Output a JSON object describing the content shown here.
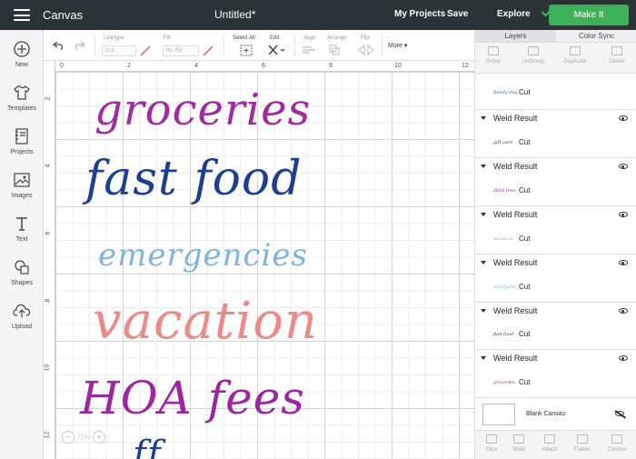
{
  "topbar": {
    "app_name": "Canvas",
    "doc_title": "Untitled*",
    "my_projects": "My Projects",
    "save": "Save",
    "explore": "Explore",
    "make_it": "Make It"
  },
  "sidebar": {
    "items": [
      {
        "label": "New",
        "icon": "plus-circle-icon"
      },
      {
        "label": "Templates",
        "icon": "shirt-icon"
      },
      {
        "label": "Projects",
        "icon": "notebook-icon"
      },
      {
        "label": "Images",
        "icon": "image-icon"
      },
      {
        "label": "Text",
        "icon": "text-icon"
      },
      {
        "label": "Shapes",
        "icon": "shapes-icon"
      },
      {
        "label": "Upload",
        "icon": "cloud-upload-icon"
      }
    ]
  },
  "toolbar": {
    "linetype_label": "Linetype",
    "linetype_value": "Cut",
    "fill_label": "Fill",
    "fill_value": "No Fill",
    "select_all": "Select All",
    "edit": "Edit",
    "align": "Align",
    "arrange": "Arrange",
    "flip": "Flip",
    "more": "More"
  },
  "rulers": {
    "top": [
      "0",
      "2",
      "4",
      "6",
      "8",
      "10",
      "12"
    ],
    "left": [
      "2",
      "4",
      "6",
      "8",
      "10",
      "12"
    ]
  },
  "canvas": {
    "words": [
      {
        "text": "groceries",
        "color": "#a12a9e"
      },
      {
        "text": "fast food",
        "color": "#1e3f8f"
      },
      {
        "text": "emergencies",
        "color": "#7fb3e0"
      },
      {
        "text": "vacation",
        "color": "#ec8a88"
      },
      {
        "text": "HOA fees",
        "color": "#9e24a3"
      }
    ],
    "zoom": "75%"
  },
  "right_panel": {
    "tabs": [
      "Layers",
      "Color Sync"
    ],
    "actions": [
      "Group",
      "UnGroup",
      "Duplicate",
      "Delete"
    ],
    "layers": [
      {
        "title": "",
        "thumb": "family stuff",
        "thumb_color": "#3a5aa8",
        "op": "Cut"
      },
      {
        "title": "Weld Result",
        "thumb": "gift care",
        "thumb_color": "#1e3f8f",
        "op": "Cut"
      },
      {
        "title": "Weld Result",
        "thumb": "HOA fees",
        "thumb_color": "#9e24a3",
        "op": "Cut"
      },
      {
        "title": "Weld Result",
        "thumb": "vacation",
        "thumb_color": "#ec8a88",
        "op": "Cut"
      },
      {
        "title": "Weld Result",
        "thumb": "emergency",
        "thumb_color": "#7fb3e0",
        "op": "Cut"
      },
      {
        "title": "Weld Result",
        "thumb": "fast food",
        "thumb_color": "#1e3f8f",
        "op": "Cut"
      },
      {
        "title": "Weld Result",
        "thumb": "groceries",
        "thumb_color": "#a12a9e",
        "op": "Cut"
      }
    ],
    "blank_canvas": "Blank Canvas",
    "bottom_actions": [
      "Slice",
      "Weld",
      "Attach",
      "Flatten",
      "Contour"
    ]
  }
}
